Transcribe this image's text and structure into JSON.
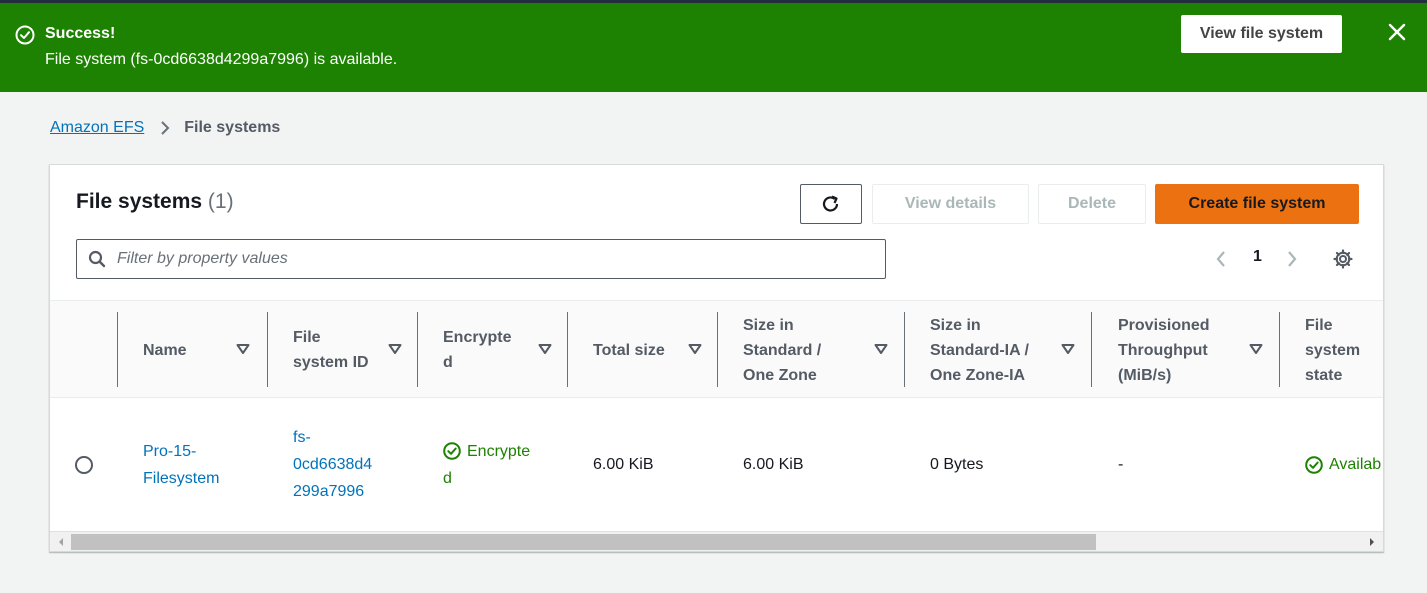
{
  "flash": {
    "title": "Success!",
    "message": "File system (fs-0cd6638d4299a7996) is available.",
    "action_label": "View file system",
    "icon": "check-circle-icon",
    "close_icon": "close-icon",
    "color": "#1d8102"
  },
  "breadcrumb": {
    "root": "Amazon EFS",
    "current": "File systems"
  },
  "panel": {
    "title": "File systems",
    "count": "(1)",
    "refresh_icon": "refresh-icon",
    "view_details_label": "View details",
    "delete_label": "Delete",
    "create_label": "Create file system",
    "create_color": "#ec7211"
  },
  "filter": {
    "placeholder": "Filter by property values",
    "value": ""
  },
  "pagination": {
    "current_page": "1"
  },
  "table": {
    "columns": [
      "Name",
      "File system ID",
      "Encrypted",
      "Total size",
      "Size in Standard / One Zone",
      "Size in Standard-IA / One Zone-IA",
      "Provisioned Throughput (MiB/s)",
      "File system state"
    ],
    "column_display": [
      [
        "Name"
      ],
      [
        "File",
        "system ID"
      ],
      [
        "Encrypte",
        "d"
      ],
      [
        "Total size"
      ],
      [
        "Size in",
        "Standard /",
        "One Zone"
      ],
      [
        "Size in",
        "Standard-IA /",
        "One Zone-IA"
      ],
      [
        "Provisioned",
        "Throughput",
        "(MiB/s)"
      ],
      [
        "File",
        "system",
        "state"
      ]
    ],
    "rows": [
      {
        "name_lines": [
          "Pro-15-",
          "Filesystem"
        ],
        "id_lines": [
          "fs-",
          "0cd6638d4",
          "299a7996"
        ],
        "encrypted_lines": [
          "Encrypte",
          "d"
        ],
        "total_size": "6.00 KiB",
        "size_standard": "6.00 KiB",
        "size_ia": "0 Bytes",
        "throughput": "-",
        "state": "Availab"
      }
    ]
  }
}
